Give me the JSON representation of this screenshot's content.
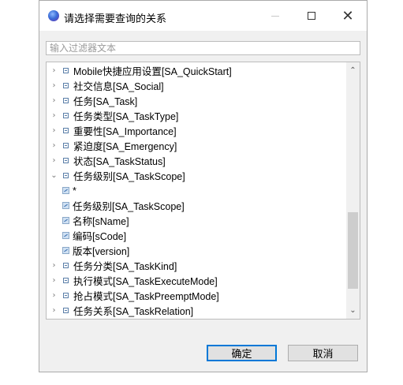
{
  "window": {
    "title": "请选择需要查询的关系"
  },
  "filter": {
    "placeholder": "输入过滤器文本",
    "value": ""
  },
  "tree": {
    "items": [
      {
        "kind": "table",
        "twisty": "›",
        "label": "Mobile快捷应用设置[SA_QuickStart]"
      },
      {
        "kind": "table",
        "twisty": "›",
        "label": "社交信息[SA_Social]"
      },
      {
        "kind": "table",
        "twisty": "›",
        "label": "任务[SA_Task]"
      },
      {
        "kind": "table",
        "twisty": "›",
        "label": "任务类型[SA_TaskType]"
      },
      {
        "kind": "table",
        "twisty": "›",
        "label": "重要性[SA_Importance]"
      },
      {
        "kind": "table",
        "twisty": "›",
        "label": "紧迫度[SA_Emergency]"
      },
      {
        "kind": "table",
        "twisty": "›",
        "label": "状态[SA_TaskStatus]"
      },
      {
        "kind": "table",
        "twisty": "⌄",
        "label": "任务级别[SA_TaskScope]"
      },
      {
        "kind": "column",
        "twisty": "",
        "label": "*"
      },
      {
        "kind": "column",
        "twisty": "",
        "label": "任务级别[SA_TaskScope]"
      },
      {
        "kind": "column",
        "twisty": "",
        "label": "名称[sName]"
      },
      {
        "kind": "column",
        "twisty": "",
        "label": "编码[sCode]"
      },
      {
        "kind": "column",
        "twisty": "",
        "label": "版本[version]"
      },
      {
        "kind": "table",
        "twisty": "›",
        "label": "任务分类[SA_TaskKind]"
      },
      {
        "kind": "table",
        "twisty": "›",
        "label": "执行模式[SA_TaskExecuteMode]"
      },
      {
        "kind": "table",
        "twisty": "›",
        "label": "抢占模式[SA_TaskPreemptMode]"
      },
      {
        "kind": "table",
        "twisty": "›",
        "label": "任务关系[SA_TaskRelation]"
      }
    ],
    "scroll_position_fraction": 0.9
  },
  "buttons": {
    "ok": "确定",
    "cancel": "取消"
  }
}
